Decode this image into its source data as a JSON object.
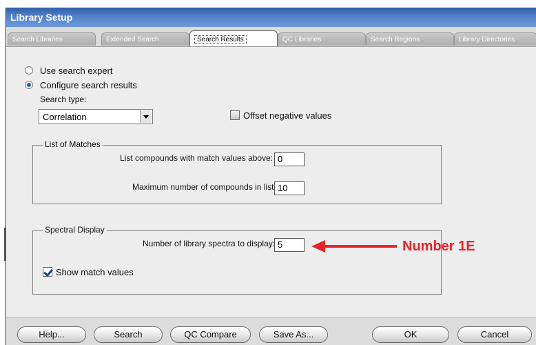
{
  "window": {
    "title": "Library Setup"
  },
  "tabs": [
    {
      "label": "Search Libraries",
      "active": false
    },
    {
      "label": "Extended Search",
      "active": false
    },
    {
      "label": "Search Results",
      "active": true
    },
    {
      "label": "QC Libraries",
      "active": false
    },
    {
      "label": "Search Regions",
      "active": false
    },
    {
      "label": "Library Directories",
      "active": false
    }
  ],
  "search_mode": {
    "option_expert": "Use search expert",
    "option_configure": "Configure search results",
    "selected": "configure"
  },
  "search_type": {
    "label": "Search type:",
    "value": "Correlation"
  },
  "offset_negative": {
    "label": "Offset negative values",
    "checked": false
  },
  "list_of_matches": {
    "title": "List of Matches",
    "min_match_label": "List compounds with match values above:",
    "min_match_value": "0",
    "max_compounds_label": "Maximum number of compounds in list:",
    "max_compounds_value": "10"
  },
  "spectral_display": {
    "title": "Spectral Display",
    "num_spectra_label": "Number of library spectra to display:",
    "num_spectra_value": "5",
    "show_match_label": "Show match values",
    "show_match_checked": true
  },
  "annotation": {
    "text": "Number 1E",
    "color": "#e8232c"
  },
  "buttons": {
    "help": "Help...",
    "search": "Search",
    "qc_compare": "QC Compare",
    "save_as": "Save As...",
    "ok": "OK",
    "cancel": "Cancel"
  }
}
